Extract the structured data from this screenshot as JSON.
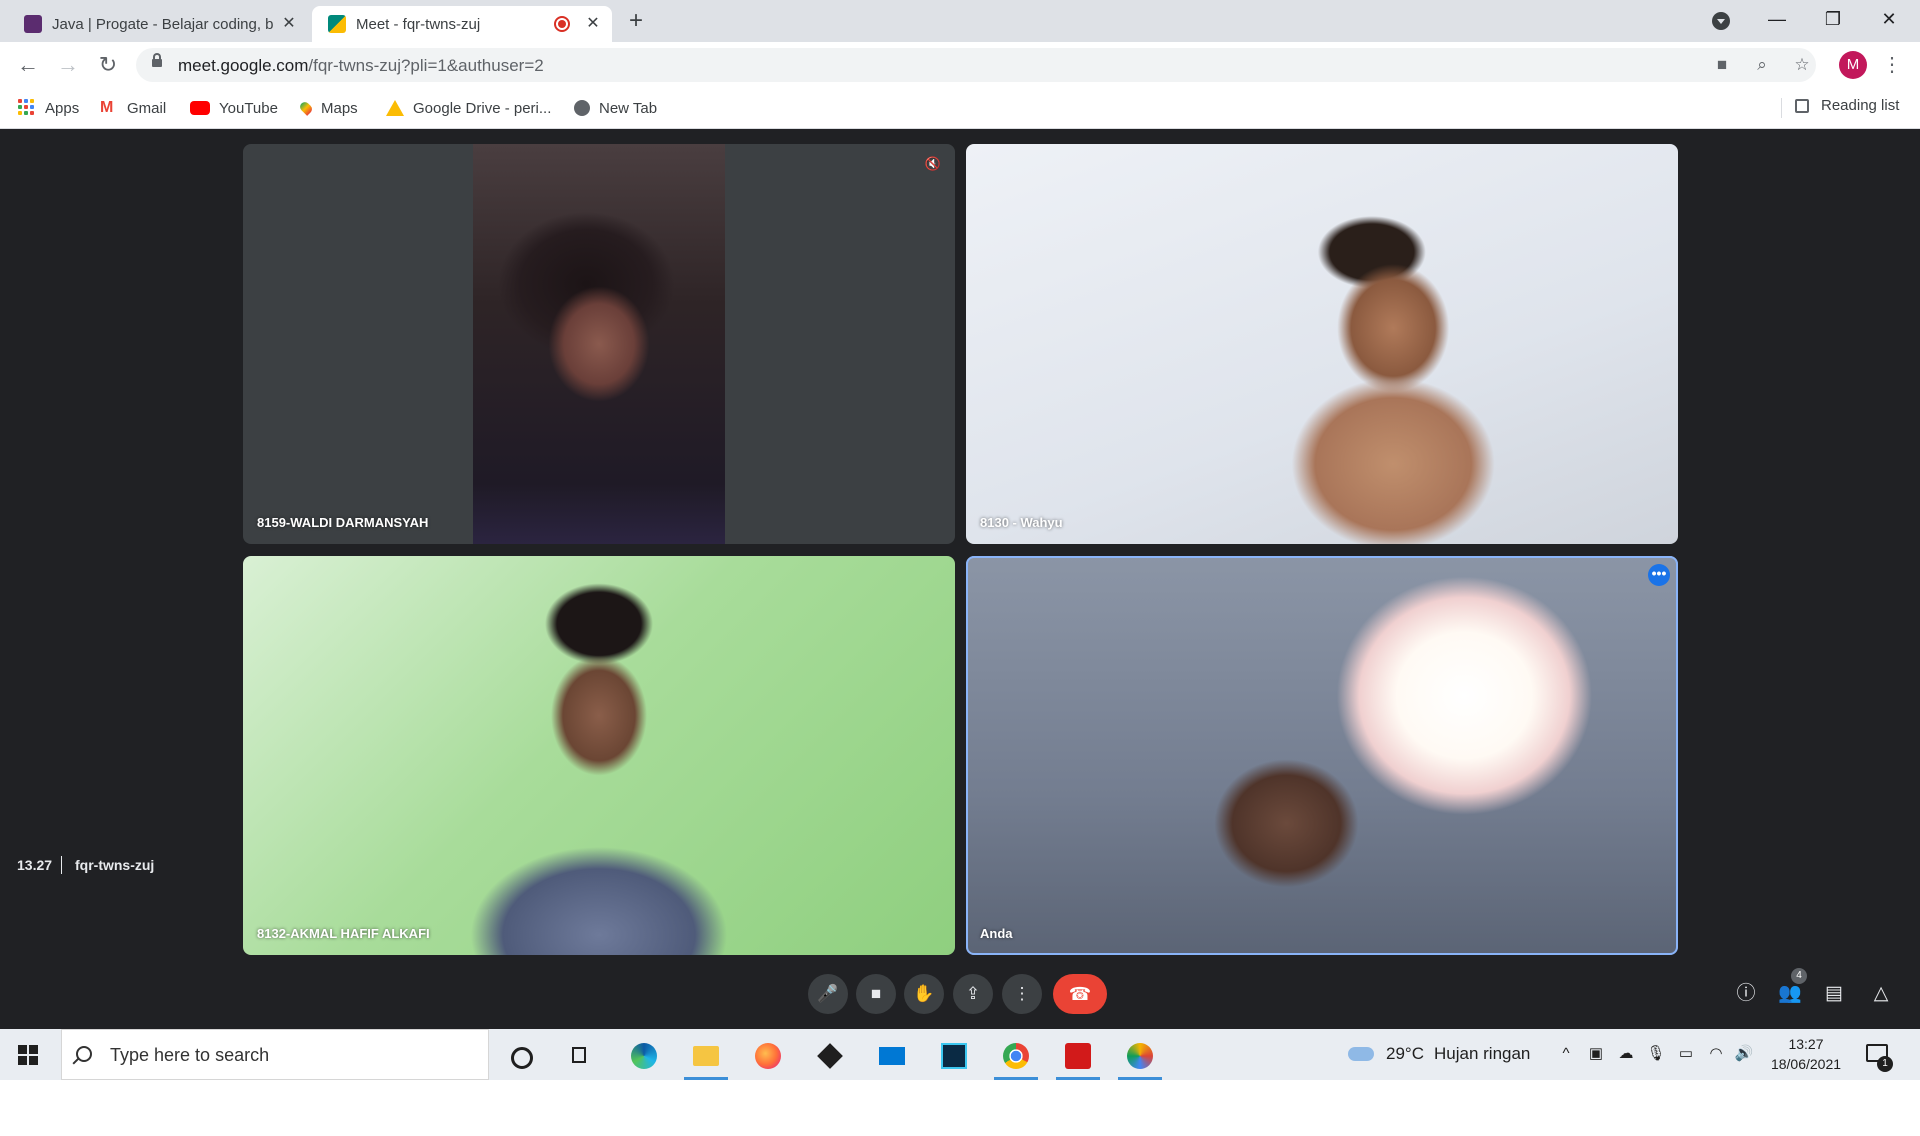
{
  "browser": {
    "tabs": [
      {
        "title": "Java | Progate - Belajar coding, b",
        "favicon_color": "#5b2c6f"
      },
      {
        "title": "Meet - fqr-twns-zuj",
        "favicon_color": "#00897b",
        "recording": true
      }
    ],
    "tab_close": "✕",
    "new_tab": "+",
    "window_controls": {
      "minimize": "—",
      "restore": "❐",
      "close": "✕"
    },
    "nav": {
      "back": "←",
      "forward": "→",
      "reload": "↻"
    },
    "url": {
      "host": "meet.google.com",
      "path": "/fqr-twns-zuj?pli=1&authuser=2"
    },
    "omnibox_icons": {
      "camera": "■",
      "zoom": "⌕",
      "star": "☆"
    },
    "profile_initial": "M",
    "menu": "⋮"
  },
  "bookmarks": {
    "items": [
      {
        "label": "Apps",
        "icon": "apps-grid-icon"
      },
      {
        "label": "Gmail",
        "icon": "gmail-icon"
      },
      {
        "label": "YouTube",
        "icon": "youtube-icon"
      },
      {
        "label": "Maps",
        "icon": "maps-pin-icon"
      },
      {
        "label": "Google Drive - peri...",
        "icon": "drive-icon"
      },
      {
        "label": "New Tab",
        "icon": "globe-icon"
      }
    ],
    "reading_list": "Reading list"
  },
  "meet": {
    "participants": [
      {
        "name": "8159-WALDI DARMANSYAH",
        "muted": true
      },
      {
        "name": "8130 - Wahyu"
      },
      {
        "name": "8132-AKMAL HAFIF ALKAFI"
      },
      {
        "name": "Anda",
        "active_speaker_outline": true
      }
    ],
    "time": "13.27",
    "meeting_code": "fqr-twns-zuj",
    "people_count": "4",
    "icons": {
      "mic": "🎤",
      "camera": "■",
      "raise_hand": "✋",
      "present": "⇪",
      "more": "⋮",
      "end_call": "☎",
      "info": "ⓘ",
      "people": "👥",
      "chat": "▤",
      "activities": "△",
      "muted": "🔇",
      "tile_more": "•••"
    },
    "colors": {
      "end_call": "#ea4335",
      "active_outline": "#8ab4f8",
      "background": "#202124"
    }
  },
  "taskbar": {
    "search_placeholder": "Type here to search",
    "weather": {
      "temp": "29°C",
      "text": "Hujan ringan"
    },
    "time": "13:27",
    "date": "18/06/2021",
    "notifications": "1",
    "tray_icons": {
      "chevron": "^",
      "meet": "▣",
      "cloud": "☁",
      "mic": "🎙",
      "battery": "▭",
      "wifi": "◠",
      "volume": "🔊"
    }
  }
}
